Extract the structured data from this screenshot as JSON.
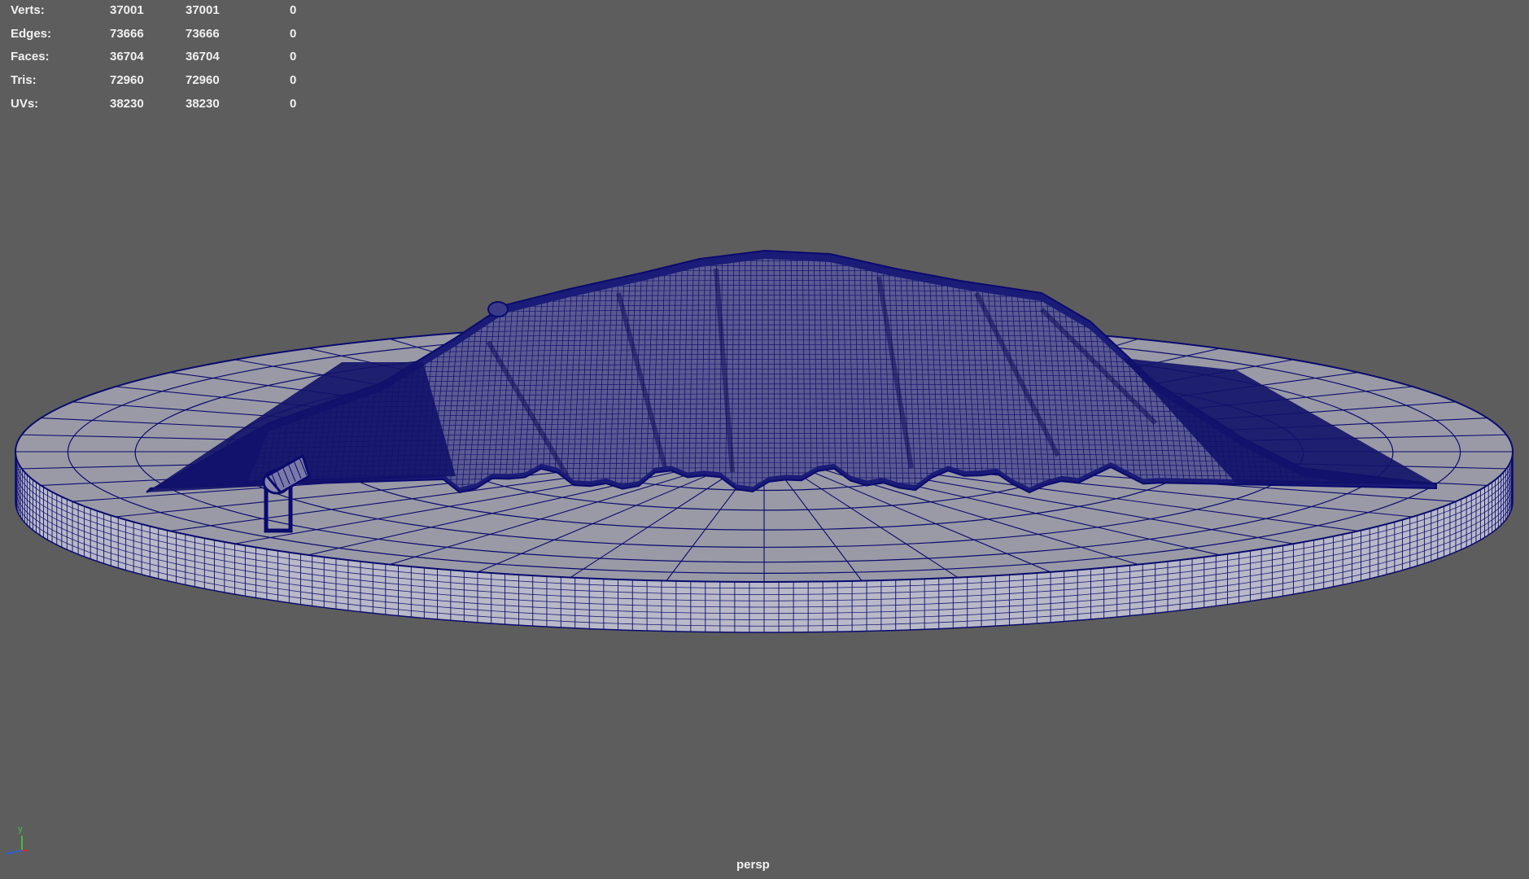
{
  "hud": {
    "rows": [
      {
        "label": "Verts:",
        "v1": "37001",
        "v2": "37001",
        "v3": "0"
      },
      {
        "label": "Edges:",
        "v1": "73666",
        "v2": "73666",
        "v3": "0"
      },
      {
        "label": "Faces:",
        "v1": "36704",
        "v2": "36704",
        "v3": "0"
      },
      {
        "label": "Tris:",
        "v1": "72960",
        "v2": "72960",
        "v3": "0"
      },
      {
        "label": "UVs:",
        "v1": "38230",
        "v2": "38230",
        "v3": "0"
      }
    ]
  },
  "viewport": {
    "camera": "persp",
    "background_color": "#5d5d5d",
    "wire_color": "#0a0a6e"
  },
  "axis_gizmo": {
    "y_label": "y",
    "y_color": "#3fbf3f",
    "x_color": "#d03030",
    "z_color": "#3060d0"
  }
}
